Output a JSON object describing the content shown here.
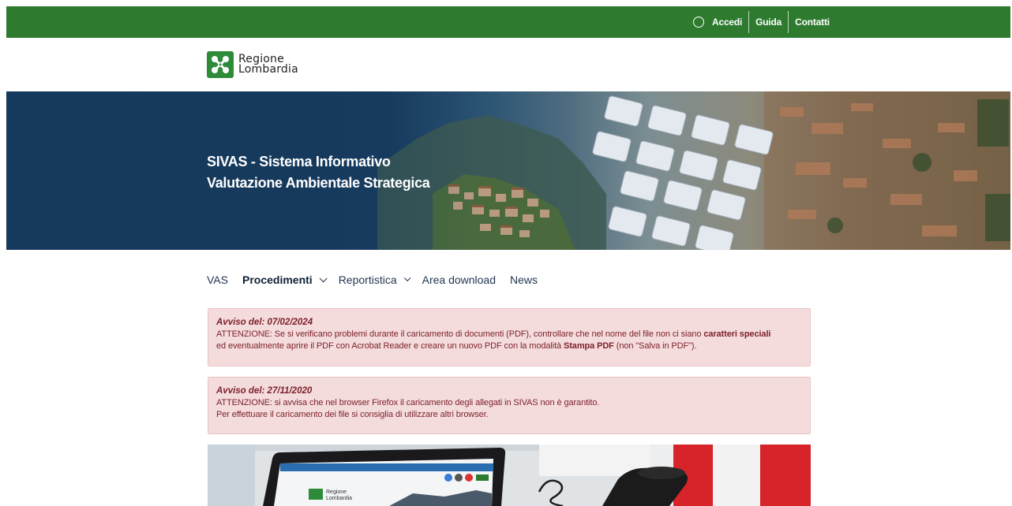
{
  "topbar": {
    "accedi": "Accedi",
    "guida": "Guida",
    "contatti": "Contatti",
    "color": "#2e7b2f"
  },
  "logo": {
    "line1": "Regione",
    "line2": "Lombardia"
  },
  "hero": {
    "title_line1": "SIVAS - Sistema Informativo",
    "title_line2": "Valutazione Ambientale Strategica"
  },
  "nav": {
    "items": [
      {
        "label": "VAS",
        "active": false,
        "dropdown": false
      },
      {
        "label": "Procedimenti",
        "active": true,
        "dropdown": true
      },
      {
        "label": "Reportistica",
        "active": false,
        "dropdown": true
      },
      {
        "label": "Area download",
        "active": false,
        "dropdown": false
      },
      {
        "label": "News",
        "active": false,
        "dropdown": false
      }
    ]
  },
  "alerts": [
    {
      "title": "Avviso del: 07/02/2024",
      "line1_pre": "ATTENZIONE: Se si verificano problemi durante il caricamento di documenti (PDF), controllare che nel nome del file non ci siano ",
      "line1_bold": "caratteri speciali",
      "line2_pre": "ed eventualmente aprire il PDF con Acrobat Reader e creare un nuovo PDF con la modalità ",
      "line2_bold": "Stampa PDF",
      "line2_post": " (non \"Salva in PDF\")."
    },
    {
      "title": "Avviso del: 27/11/2020",
      "line1": "ATTENZIONE: si avvisa che nel browser Firefox il caricamento degli allegati in SIVAS non è garantito.",
      "line2": "Per effettuare il caricamento dei file si consiglia di utilizzare altri browser."
    }
  ],
  "photo": {
    "screen_logo_line1": "Regione",
    "screen_logo_line2": "Lombardia"
  },
  "colors": {
    "alert_bg": "#f5dcdc",
    "alert_text": "#7a1f2b",
    "hero_blue": "#143758"
  }
}
